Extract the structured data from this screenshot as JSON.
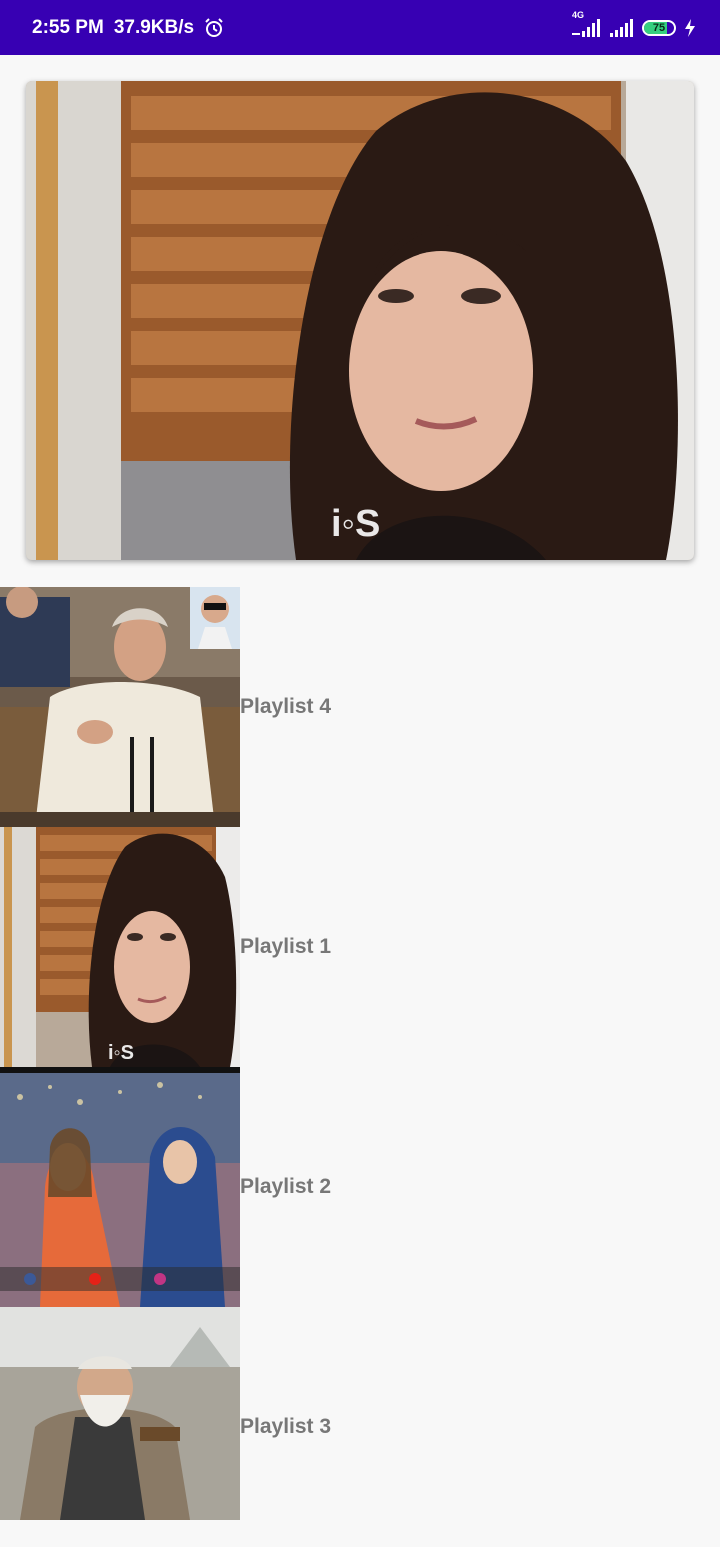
{
  "status_bar": {
    "time": "2:55 PM",
    "speed": "37.9KB/s",
    "network_type": "4G",
    "battery_level": "75",
    "battery_fraction": 0.75,
    "icons": [
      "alarm-icon",
      "signal-icon",
      "wifi-signal-icon",
      "battery-icon",
      "charging-icon"
    ],
    "background_color": "#3700b3"
  },
  "hero": {
    "image": "featured-video-thumbnail"
  },
  "playlists": [
    {
      "label": "Playlist 4",
      "image": "parliament-speaker-thumbnail"
    },
    {
      "label": "Playlist 1",
      "image": "woman-portrait-thumbnail"
    },
    {
      "label": "Playlist 2",
      "image": "street-interview-thumbnail"
    },
    {
      "label": "Playlist 3",
      "image": "old-man-thumbnail"
    }
  ],
  "colors": {
    "label_text": "#777777",
    "background": "#f8f8f8"
  }
}
